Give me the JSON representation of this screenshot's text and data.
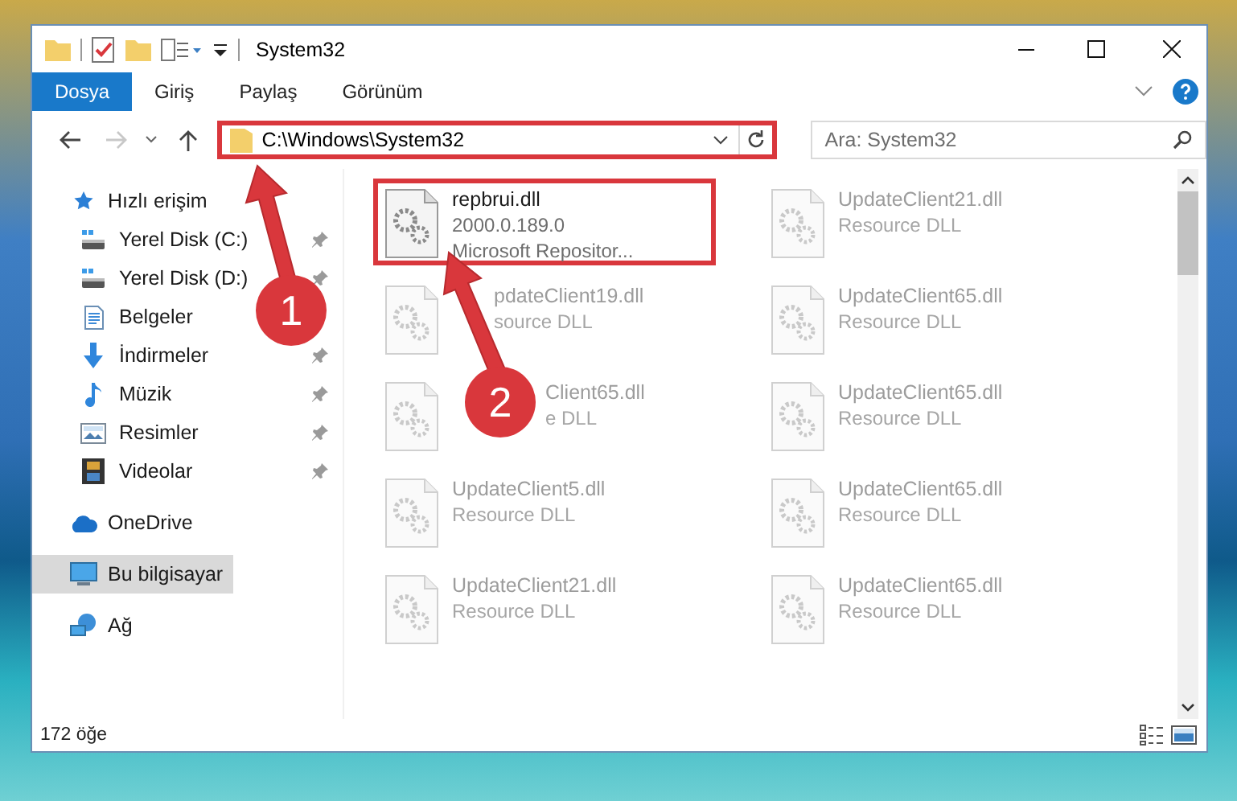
{
  "window": {
    "title": "System32"
  },
  "ribbon": {
    "tabs": [
      {
        "label": "Dosya",
        "selected": true
      },
      {
        "label": "Giriş",
        "selected": false
      },
      {
        "label": "Paylaş",
        "selected": false
      },
      {
        "label": "Görünüm",
        "selected": false
      }
    ]
  },
  "address_bar": {
    "value": "C:\\Windows\\System32",
    "highlighted": true
  },
  "search": {
    "placeholder": "Ara: System32"
  },
  "sidebar": {
    "items": [
      {
        "label": "Hızlı erişim",
        "kind": "star",
        "selected": false,
        "children": [
          {
            "label": "Yerel Disk (C:)",
            "kind": "drive",
            "pinned": true,
            "selected": false
          },
          {
            "label": "Yerel Disk (D:)",
            "kind": "drive",
            "pinned": true,
            "selected": false
          },
          {
            "label": "Belgeler",
            "kind": "docs",
            "pinned": false,
            "selected": false
          },
          {
            "label": "İndirmeler",
            "kind": "download",
            "pinned": true,
            "selected": false
          },
          {
            "label": "Müzik",
            "kind": "music",
            "pinned": true,
            "selected": false
          },
          {
            "label": "Resimler",
            "kind": "pictures",
            "pinned": true,
            "selected": false
          },
          {
            "label": "Videolar",
            "kind": "videos",
            "pinned": true,
            "selected": false
          }
        ]
      },
      {
        "label": "OneDrive",
        "kind": "cloud",
        "selected": false
      },
      {
        "label": "Bu bilgisayar",
        "kind": "computer",
        "selected": true
      },
      {
        "label": "Ağ",
        "kind": "network",
        "selected": false
      }
    ]
  },
  "files": [
    {
      "kind": "plain",
      "name": "repbrui.dll",
      "lines": [
        "2000.0.189.0",
        "Microsoft Repositor..."
      ],
      "faded": false,
      "highlighted": true
    },
    {
      "kind": "plain",
      "name": "UpdateClient21.dll",
      "lines": [
        "Resource DLL"
      ],
      "faded": true,
      "highlighted": false
    },
    {
      "kind": "under-arrow",
      "name": "pdateClient19.dll",
      "lines": [
        "source DLL"
      ],
      "faded": true,
      "highlighted": false
    },
    {
      "kind": "plain",
      "name": "UpdateClient65.dll",
      "lines": [
        "Resource DLL"
      ],
      "faded": true,
      "highlighted": false
    },
    {
      "kind": "under-badge",
      "name": "Client65.dll",
      "lines": [
        "e DLL"
      ],
      "faded": true,
      "highlighted": false
    },
    {
      "kind": "plain",
      "name": "UpdateClient65.dll",
      "lines": [
        "Resource DLL"
      ],
      "faded": true,
      "highlighted": false
    },
    {
      "kind": "plain",
      "name": "UpdateClient5.dll",
      "lines": [
        "Resource DLL"
      ],
      "faded": true,
      "highlighted": false
    },
    {
      "kind": "plain",
      "name": "UpdateClient65.dll",
      "lines": [
        "Resource DLL"
      ],
      "faded": true,
      "highlighted": false
    },
    {
      "kind": "plain",
      "name": "UpdateClient21.dll",
      "lines": [
        "Resource DLL"
      ],
      "faded": true,
      "highlighted": false
    },
    {
      "kind": "plain",
      "name": "UpdateClient65.dll",
      "lines": [
        "Resource DLL"
      ],
      "faded": true,
      "highlighted": false
    }
  ],
  "status_bar": {
    "count": "172 öğe"
  },
  "annotations": [
    {
      "label": "1"
    },
    {
      "label": "2"
    }
  ]
}
